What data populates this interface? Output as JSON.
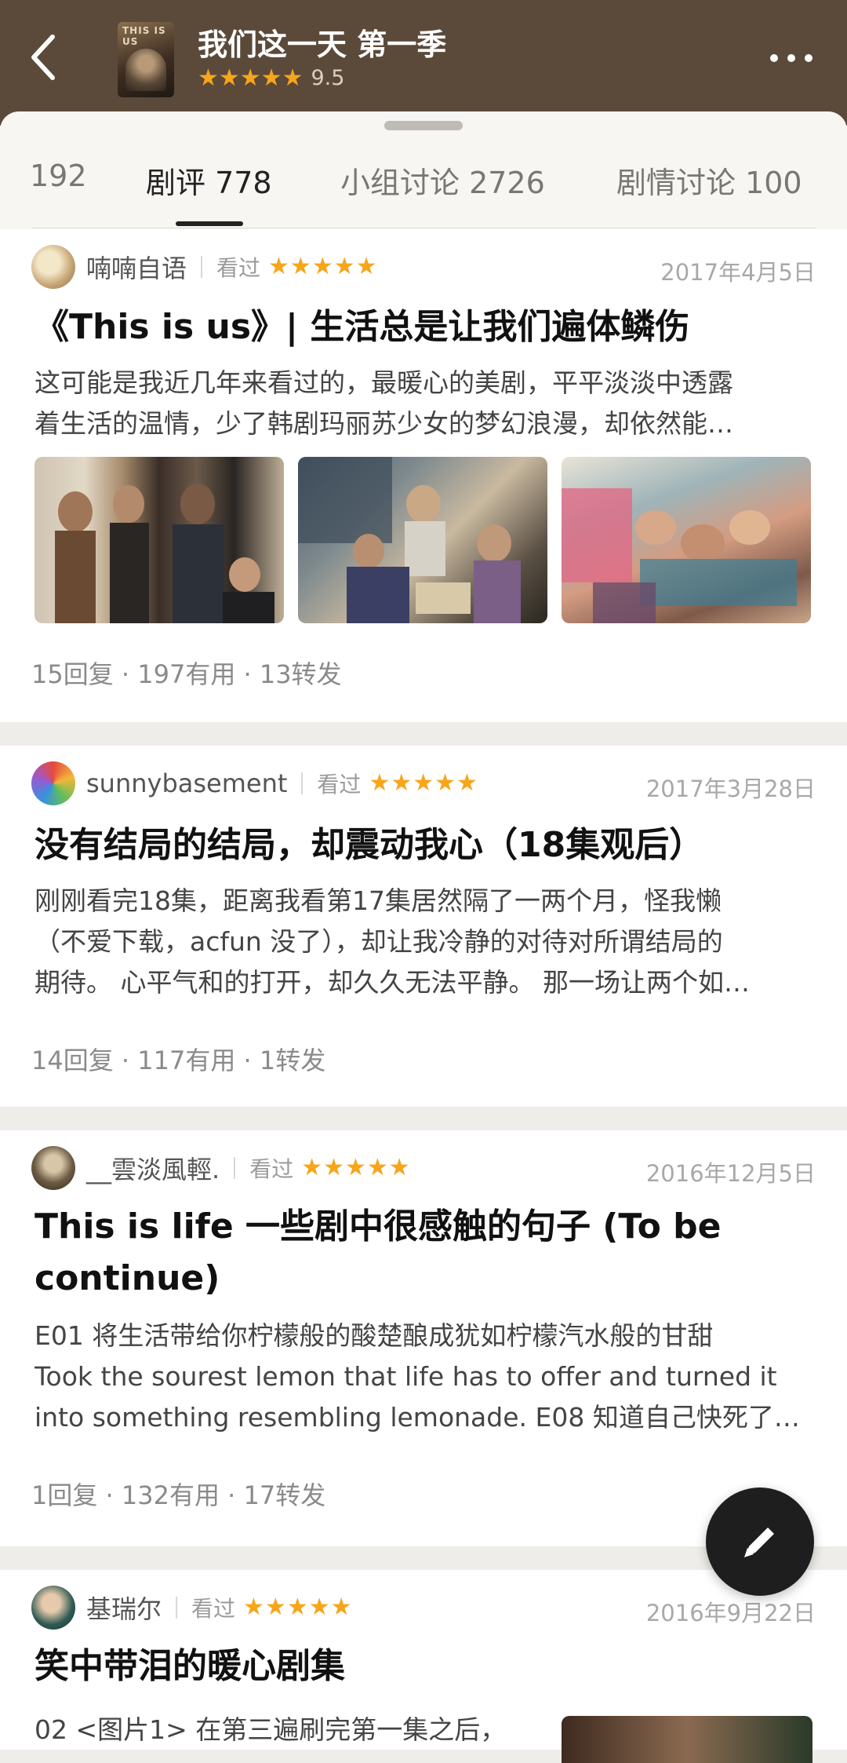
{
  "header": {
    "title": "我们这一天 第一季",
    "stars": "★★★★★",
    "score": "9.5",
    "poster_text": "THIS IS US"
  },
  "tabs": [
    {
      "label": "192"
    },
    {
      "label": "剧评 778",
      "active": true
    },
    {
      "label": "小组讨论 2726"
    },
    {
      "label": "剧情讨论 100"
    }
  ],
  "reviews": [
    {
      "user": "喃喃自语",
      "watched": "看过",
      "stars": "★★★★★",
      "date": "2017年4月5日",
      "title": "《This is us》| 生活总是让我们遍体鳞伤",
      "body": [
        "这可能是我近几年来看过的，最暖心的美剧，平平淡淡中透露",
        "着生活的温情，少了韩剧玛丽苏少女的梦幻浪漫，却依然能…"
      ],
      "stats": "15回复 · 197有用 · 13转发"
    },
    {
      "user": "sunnybasement",
      "watched": "看过",
      "stars": "★★★★★",
      "date": "2017年3月28日",
      "title": "没有结局的结局，却震动我心（18集观后）",
      "body": [
        "刚刚看完18集，距离我看第17集居然隔了一两个月，怪我懒",
        "（不爱下载，acfun 没了），却让我冷静的对待对所谓结局的",
        "期待。 心平气和的打开，却久久无法平静。 那一场让两个如…"
      ],
      "stats": "14回复 · 117有用 · 1转发"
    },
    {
      "user": "__雲淡風輕.",
      "watched": "看过",
      "stars": "★★★★★",
      "date": "2016年12月5日",
      "title_lines": [
        "This is life 一些剧中很感触的句子 (To be",
        "continue)"
      ],
      "body": [
        "E01 将生活带给你柠檬般的酸楚酿成犹如柠檬汽水般的甘甜",
        "Took the sourest lemon that life has to offer and turned it",
        "into something resembling lemonade. E08 知道自己快死了…"
      ],
      "stats": "1回复 · 132有用 · 17转发"
    },
    {
      "user": "基瑞尔",
      "watched": "看过",
      "stars": "★★★★★",
      "date": "2016年9月22日",
      "title": "笑中带泪的暖心剧集",
      "body": [
        "02 <图片1> 在第三遍刷完第一集之后，"
      ]
    }
  ]
}
